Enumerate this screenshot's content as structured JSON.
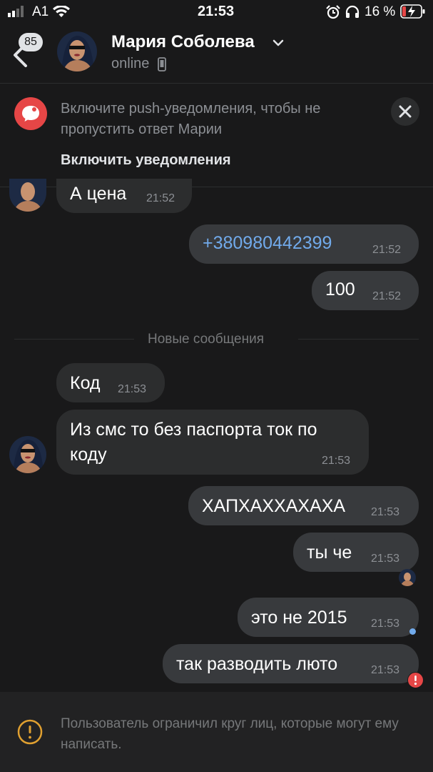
{
  "status_bar": {
    "carrier": "A1",
    "time": "21:53",
    "battery_percent": "16 %",
    "icons": [
      "signal-icon",
      "wifi-icon",
      "alarm-icon",
      "headphones-icon",
      "battery-charging-icon"
    ]
  },
  "header": {
    "back_badge": "85",
    "contact_name": "Мария Соболева",
    "presence": "online",
    "icons": [
      "back-chevron-icon",
      "chevron-down-icon",
      "mobile-phone-icon"
    ]
  },
  "notification_banner": {
    "text": "Включите push-уведомления, чтобы не пропустить ответ Марии",
    "action": "Включить уведомления",
    "icons": [
      "chat-bubble-icon",
      "close-icon"
    ]
  },
  "messages": [
    {
      "direction": "in",
      "text": "А цена",
      "time": "21:52"
    },
    {
      "direction": "out",
      "text": "+380980442399",
      "time": "21:52",
      "is_link": true
    },
    {
      "direction": "out",
      "text": "100",
      "time": "21:52"
    },
    {
      "direction": "in",
      "text": "Код",
      "time": "21:53"
    },
    {
      "direction": "in",
      "text_line1": "Из смс то без паспорта ток по",
      "text_line2": "коду",
      "time": "21:53"
    },
    {
      "direction": "out",
      "text": "ХАПХАХХАХАХА",
      "time": "21:53"
    },
    {
      "direction": "out",
      "text": "ты че",
      "time": "21:53"
    },
    {
      "direction": "out",
      "text": "это не 2015",
      "time": "21:53"
    },
    {
      "direction": "out",
      "text": "так разводить люто",
      "time": "21:53",
      "status": "error"
    }
  ],
  "new_messages_divider": "Новые сообщения",
  "footer": {
    "text": "Пользователь ограничил круг лиц, которые могут ему написать.",
    "icon": "warning-circle-icon"
  },
  "colors": {
    "background": "#19191a",
    "bubble_in": "#2c2d2e",
    "bubble_out": "#383a3d",
    "link": "#71aaeb",
    "accent_red": "#e64646",
    "warning_orange": "#e0a030",
    "unread_dot": "#71aaeb"
  }
}
